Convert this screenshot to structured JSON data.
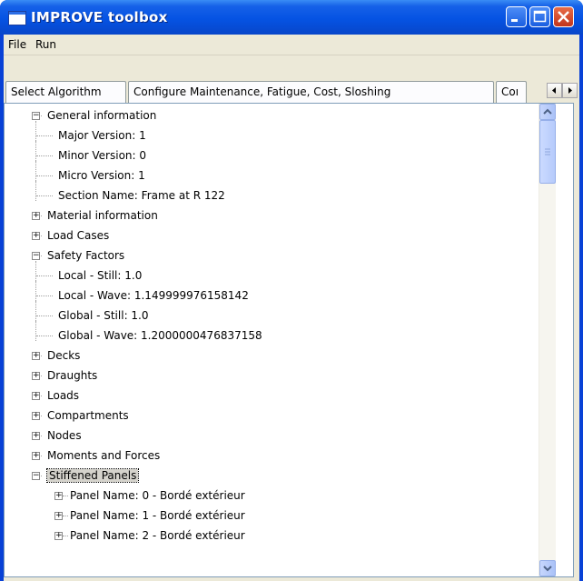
{
  "window": {
    "title": "IMPROVE toolbox"
  },
  "menu": [
    {
      "label": "File"
    },
    {
      "label": "Run"
    }
  ],
  "tabs": [
    {
      "label": "Select Algorithm"
    },
    {
      "label": "Configure Maintenance, Fatigue, Cost, Sloshing"
    },
    {
      "label": "Coı"
    }
  ],
  "tree": {
    "nodes": [
      {
        "label": "General information",
        "level": 0,
        "state": "expanded"
      },
      {
        "label": "Major Version: 1",
        "level": 1,
        "state": "leaf"
      },
      {
        "label": "Minor Version: 0",
        "level": 1,
        "state": "leaf"
      },
      {
        "label": "Micro Version: 1",
        "level": 1,
        "state": "leaf"
      },
      {
        "label": "Section Name: Frame at R 122",
        "level": 1,
        "state": "leaf"
      },
      {
        "label": "Material information",
        "level": 0,
        "state": "collapsed"
      },
      {
        "label": "Load Cases",
        "level": 0,
        "state": "collapsed"
      },
      {
        "label": "Safety Factors",
        "level": 0,
        "state": "expanded"
      },
      {
        "label": "Local - Still: 1.0",
        "level": 1,
        "state": "leaf"
      },
      {
        "label": "Local - Wave: 1.149999976158142",
        "level": 1,
        "state": "leaf"
      },
      {
        "label": "Global - Still: 1.0",
        "level": 1,
        "state": "leaf"
      },
      {
        "label": "Global - Wave: 1.2000000476837158",
        "level": 1,
        "state": "leaf"
      },
      {
        "label": "Decks",
        "level": 0,
        "state": "collapsed"
      },
      {
        "label": "Draughts",
        "level": 0,
        "state": "collapsed"
      },
      {
        "label": "Loads",
        "level": 0,
        "state": "collapsed"
      },
      {
        "label": "Compartments",
        "level": 0,
        "state": "collapsed"
      },
      {
        "label": "Nodes",
        "level": 0,
        "state": "collapsed"
      },
      {
        "label": "Moments and Forces",
        "level": 0,
        "state": "collapsed"
      },
      {
        "label": "Stiffened Panels",
        "level": 0,
        "state": "expanded",
        "selected": true
      },
      {
        "label": "Panel Name: 0 - Bordé extérieur",
        "level": 1,
        "state": "collapsed"
      },
      {
        "label": "Panel Name: 1 - Bordé extérieur",
        "level": 1,
        "state": "collapsed"
      },
      {
        "label": "Panel Name: 2 - Bordé extérieur",
        "level": 1,
        "state": "collapsed"
      }
    ]
  },
  "icons": {
    "minimize": "minimize-icon",
    "maximize": "maximize-icon",
    "close": "close-icon",
    "expand": "plus-box-icon",
    "collapse": "minus-box-icon"
  },
  "colors": {
    "titlebar": "#0553e3",
    "close_button": "#c2351c",
    "window_bg": "#ece9d8",
    "selection": "#d5d3cc"
  }
}
